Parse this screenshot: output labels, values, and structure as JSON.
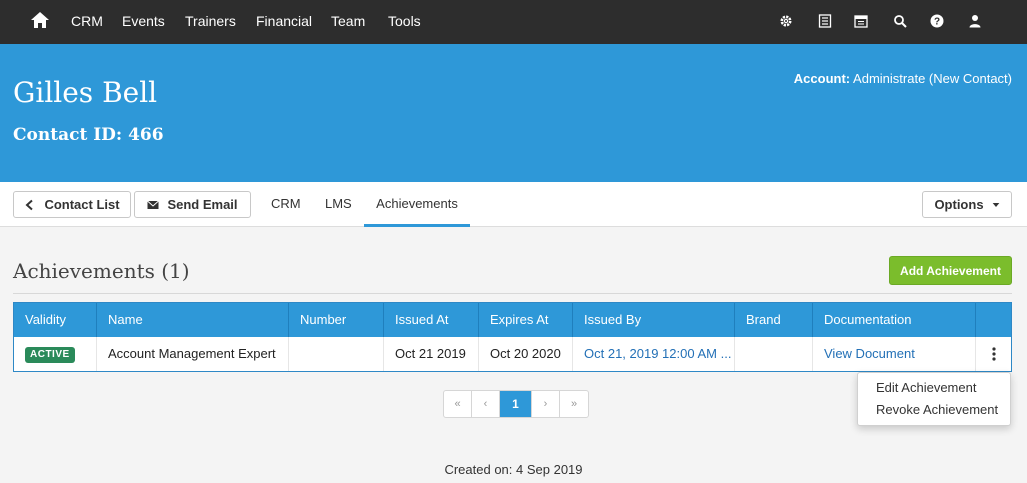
{
  "nav": {
    "items": [
      "CRM",
      "Events",
      "Trainers",
      "Financial",
      "Team",
      "Tools"
    ],
    "right_icons": [
      "gear-icon",
      "list-icon",
      "calendar-icon",
      "search-icon",
      "help-icon",
      "user-icon"
    ]
  },
  "header": {
    "name": "Gilles Bell",
    "contact_id": "Contact ID: 466",
    "account_label": "Account:",
    "account_value": "Administrate (New Contact)"
  },
  "tabbar": {
    "contact_list": "Contact List",
    "send_email": "Send Email",
    "tabs": [
      "CRM",
      "LMS",
      "Achievements"
    ],
    "active_tab": "Achievements",
    "options": "Options"
  },
  "section": {
    "title": "Achievements (1)",
    "add_button": "Add Achievement"
  },
  "table": {
    "columns": [
      "Validity",
      "Name",
      "Number",
      "Issued At",
      "Expires At",
      "Issued By",
      "Brand",
      "Documentation",
      ""
    ],
    "rows": [
      {
        "validity": "ACTIVE",
        "name": "Account Management Expert",
        "number": "",
        "issued_at": "Oct 21 2019",
        "expires_at": "Oct 20 2020",
        "issued_by": "Oct 21, 2019 12:00 AM ...",
        "brand": "",
        "documentation": "View Document"
      }
    ]
  },
  "row_menu": {
    "items": [
      "Edit Achievement",
      "Revoke Achievement"
    ]
  },
  "pagination": {
    "first": "«",
    "prev": "‹",
    "current": "1",
    "next": "›",
    "last": "»"
  },
  "footer": {
    "created": "Created on: 4 Sep 2019"
  },
  "colors": {
    "nav_bg": "#2d2d2d",
    "brand_blue": "#2e98d8",
    "add_green": "#7bbd2c",
    "active_badge": "#2a8a5a",
    "link": "#2370b6"
  }
}
